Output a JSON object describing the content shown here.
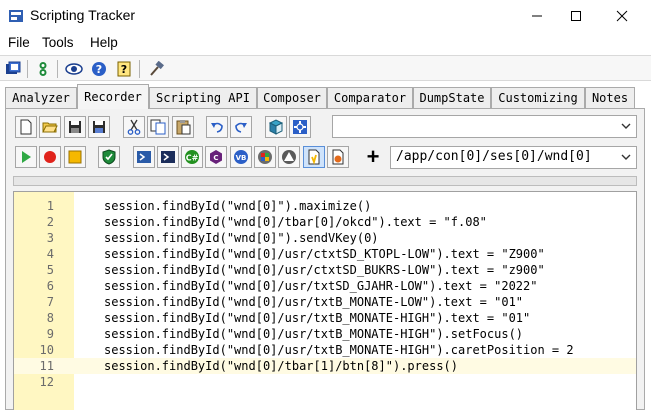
{
  "window": {
    "title": "Scripting Tracker"
  },
  "menu": {
    "items": [
      "File",
      "Tools",
      "Help"
    ]
  },
  "tabs": [
    {
      "label": "Analyzer"
    },
    {
      "label": "Recorder"
    },
    {
      "label": "Scripting API"
    },
    {
      "label": "Composer"
    },
    {
      "label": "Comparator"
    },
    {
      "label": "DumpState"
    },
    {
      "label": "Customizing"
    },
    {
      "label": "Notes"
    }
  ],
  "active_tab": "Recorder",
  "recorder": {
    "session_combo_value": "",
    "path_combo_value": "/app/con[0]/ses[0]/wnd[0]",
    "add_label": "+"
  },
  "editor": {
    "current_line": 11,
    "lines": [
      {
        "num": "1",
        "code": "session.findById(\"wnd[0]\").maximize()"
      },
      {
        "num": "2",
        "code": "session.findById(\"wnd[0]/tbar[0]/okcd\").text = \"f.08\""
      },
      {
        "num": "3",
        "code": "session.findById(\"wnd[0]\").sendVKey(0)"
      },
      {
        "num": "4",
        "code": "session.findById(\"wnd[0]/usr/ctxtSD_KTOPL-LOW\").text = \"Z900\""
      },
      {
        "num": "5",
        "code": "session.findById(\"wnd[0]/usr/ctxtSD_BUKRS-LOW\").text = \"z900\""
      },
      {
        "num": "6",
        "code": "session.findById(\"wnd[0]/usr/txtSD_GJAHR-LOW\").text = \"2022\""
      },
      {
        "num": "7",
        "code": "session.findById(\"wnd[0]/usr/txtB_MONATE-LOW\").text = \"01\""
      },
      {
        "num": "8",
        "code": "session.findById(\"wnd[0]/usr/txtB_MONATE-HIGH\").text = \"01\""
      },
      {
        "num": "9",
        "code": "session.findById(\"wnd[0]/usr/txtB_MONATE-HIGH\").setFocus()"
      },
      {
        "num": "10",
        "code": "session.findById(\"wnd[0]/usr/txtB_MONATE-HIGH\").caretPosition = 2"
      },
      {
        "num": "11",
        "code": "session.findById(\"wnd[0]/tbar[1]/btn[8]\").press()"
      },
      {
        "num": "12",
        "code": ""
      }
    ]
  },
  "colors": {
    "gutter": "#fff7c2",
    "current_line": "#fffbe3",
    "accent": "#1e6fd9"
  }
}
